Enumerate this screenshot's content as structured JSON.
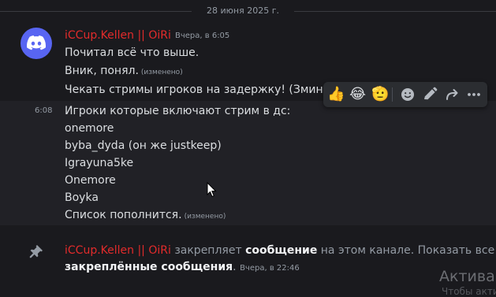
{
  "date_divider": "28 июня 2025 г.",
  "message": {
    "author": "iCCup.Kellen || OiRi",
    "timestamp": "Вчера, в 6:05",
    "lines": [
      "Почитал всё что выше.",
      "Вник, понял.",
      "Чекать стримы игроков на задержку! (Зминуть"
    ],
    "edited_label": "(изменено)"
  },
  "message2": {
    "side_time": "6:08",
    "lines": [
      "Игроки которые включают стрим в дс:",
      "onemore",
      "byba_dyda (он же justkeep)",
      "Igrayuna5ke",
      "Onemore",
      "Boyka",
      "Список пополнится."
    ],
    "edited_label": "(изменено)"
  },
  "toolbar": {
    "reactions": [
      "👍",
      "😂",
      "🫡"
    ],
    "actions": [
      "add-reaction-icon",
      "edit-icon",
      "reply-icon",
      "more-icon"
    ]
  },
  "system": {
    "author": "iCCup.Kellen || OiRi",
    "text1": "закрепляет",
    "link1": "сообщение",
    "text2": "на этом канале. Показать все",
    "link2": "закреплённые сообщения",
    "dot": ".",
    "timestamp": "Вчера, в 22:46"
  },
  "watermark": {
    "line1": "Активац",
    "line2": "Чтобы акти"
  },
  "colors": {
    "accent": "#5865f2",
    "author": "#e22b2b",
    "background": "#1a1a1e"
  }
}
